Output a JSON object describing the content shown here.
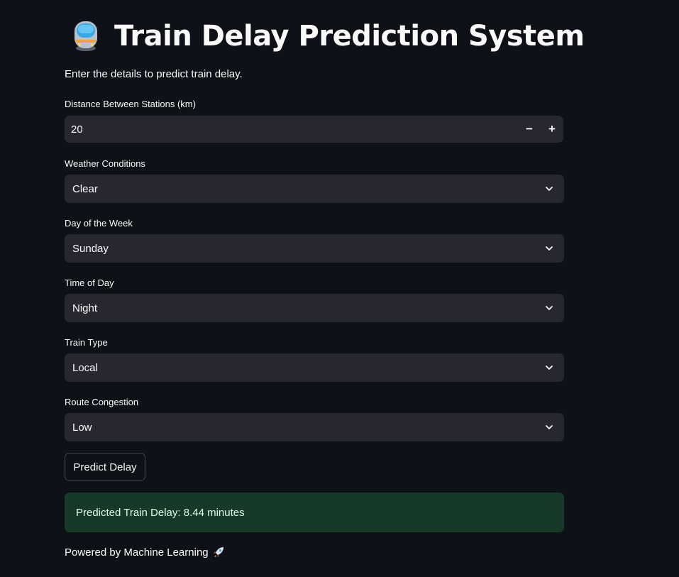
{
  "header": {
    "title": "Train Delay Prediction System",
    "icon": "train-icon"
  },
  "intro": "Enter the details to predict train delay.",
  "form": {
    "distance": {
      "label": "Distance Between Stations (km)",
      "value": "20",
      "decrement": "−",
      "increment": "+"
    },
    "weather": {
      "label": "Weather Conditions",
      "value": "Clear"
    },
    "day": {
      "label": "Day of the Week",
      "value": "Sunday"
    },
    "time": {
      "label": "Time of Day",
      "value": "Night"
    },
    "train_type": {
      "label": "Train Type",
      "value": "Local"
    },
    "congestion": {
      "label": "Route Congestion",
      "value": "Low"
    },
    "submit_label": "Predict Delay"
  },
  "result": {
    "message": "Predicted Train Delay: 8.44 minutes"
  },
  "footer": {
    "text": "Powered by Machine Learning",
    "icon": "rocket-icon"
  },
  "colors": {
    "background": "#0e1117",
    "input_bg": "#262730",
    "success_bg": "#173928",
    "text": "#fafafa"
  }
}
